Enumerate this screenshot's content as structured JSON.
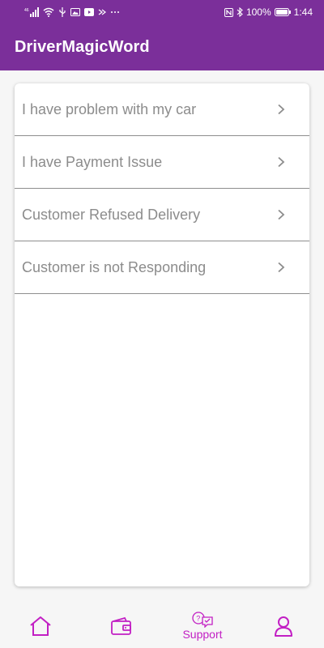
{
  "status_bar": {
    "left_icons": [
      "signal-icon",
      "wifi-icon",
      "usb-icon",
      "image-icon",
      "youtube-icon",
      "data-saver-icon",
      "more-icon"
    ],
    "right_icons": [
      "nfc-icon",
      "bluetooth-icon",
      "battery-icon"
    ],
    "battery": "100%",
    "time": "1:44"
  },
  "app_bar": {
    "title": "DriverMagicWord"
  },
  "support_options": [
    {
      "label": "I have problem with my car"
    },
    {
      "label": "I have Payment Issue"
    },
    {
      "label": "Customer Refused Delivery"
    },
    {
      "label": "Customer is not Responding"
    }
  ],
  "bottom_nav": {
    "items": [
      {
        "icon": "home-icon",
        "label": ""
      },
      {
        "icon": "wallet-icon",
        "label": ""
      },
      {
        "icon": "support-chat-icon",
        "label": "Support",
        "active": true
      },
      {
        "icon": "profile-icon",
        "label": ""
      }
    ]
  },
  "colors": {
    "primary": "#7b2f9a",
    "accent": "#c21fc4",
    "row_text": "#8c8c8c",
    "divider": "#8e8e8e"
  }
}
